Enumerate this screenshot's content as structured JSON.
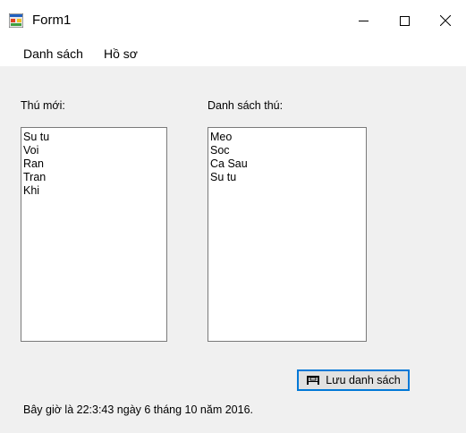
{
  "window": {
    "title": "Form1"
  },
  "menu": {
    "items": [
      "Danh sách",
      "Hồ sơ"
    ]
  },
  "labels": {
    "new_animals": "Thú mới:",
    "animal_list": "Danh sách thú:"
  },
  "lists": {
    "new_animals": [
      "Su tu",
      "Voi",
      "Ran",
      "Tran",
      "Khi"
    ],
    "animal_list": [
      "Meo",
      "Soc",
      "Ca Sau",
      "Su tu"
    ]
  },
  "buttons": {
    "save_list": "Lưu danh sách"
  },
  "status": {
    "text": "Bây giờ là 22:3:43 ngày 6 tháng 10 năm 2016."
  },
  "icons": {
    "app": "form-app-icon",
    "save": "floppy-save-icon"
  }
}
